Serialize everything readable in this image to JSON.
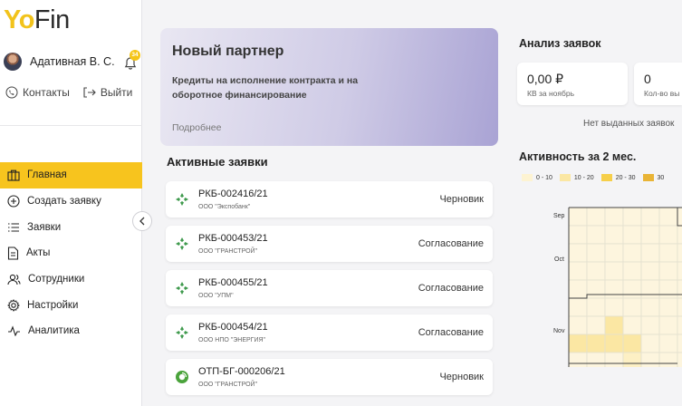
{
  "logo": {
    "part1": "Yo",
    "part2": "Fin"
  },
  "user": {
    "name": "Адативная В. С.",
    "notifications": "34"
  },
  "links": {
    "contacts": "Контакты",
    "logout": "Выйти"
  },
  "nav": [
    {
      "label": "Главная",
      "icon": "home-icon",
      "active": true
    },
    {
      "label": "Создать заявку",
      "icon": "plus-circle-icon",
      "active": false
    },
    {
      "label": "Заявки",
      "icon": "list-icon",
      "active": false
    },
    {
      "label": "Акты",
      "icon": "document-icon",
      "active": false
    },
    {
      "label": "Сотрудники",
      "icon": "users-icon",
      "active": false
    },
    {
      "label": "Настройки",
      "icon": "gear-icon",
      "active": false
    },
    {
      "label": "Аналитика",
      "icon": "pulse-icon",
      "active": false
    }
  ],
  "promo": {
    "title": "Новый партнер",
    "text": "Кредиты на исполнение контракта и на оборотное финансирование",
    "more": "Подробнее"
  },
  "active_requests": {
    "title": "Активные заявки",
    "items": [
      {
        "number": "РКБ-002416/21",
        "org": "ООО \"Экспобанк\"",
        "status": "Черновик",
        "bank": "rkb"
      },
      {
        "number": "РКБ-000453/21",
        "org": "ООО \"ГРАНСТРОЙ\"",
        "status": "Согласование",
        "bank": "rkb"
      },
      {
        "number": "РКБ-000455/21",
        "org": "ООО \"УПМ\"",
        "status": "Согласование",
        "bank": "rkb"
      },
      {
        "number": "РКБ-000454/21",
        "org": "ООО НПО \"ЭНЕРГИЯ\"",
        "status": "Согласование",
        "bank": "rkb"
      },
      {
        "number": "ОТП-БГ-000206/21",
        "org": "ООО \"ГРАНСТРОЙ\"",
        "status": "Черновик",
        "bank": "otp"
      }
    ]
  },
  "analysis": {
    "title": "Анализ заявок",
    "cards": [
      {
        "value": "0,00 ₽",
        "label": "КВ за ноябрь"
      },
      {
        "value": "0",
        "label": "Кол-во вы"
      }
    ],
    "empty_text": "Нет выданных заявок"
  },
  "activity": {
    "title": "Активность за 2 мес.",
    "legend": [
      {
        "label": "0 - 10",
        "color": "#fdf3d2"
      },
      {
        "label": "10 - 20",
        "color": "#fbe7a3"
      },
      {
        "label": "20 - 30",
        "color": "#f6cf4a"
      },
      {
        "label": "30",
        "color": "#e9b436"
      }
    ],
    "months": [
      "Sep",
      "Oct",
      "Nov"
    ]
  },
  "colors": {
    "accent": "#f7c41e",
    "rkb_green": "#3f9a4d",
    "otp_green": "#4aa33b"
  }
}
